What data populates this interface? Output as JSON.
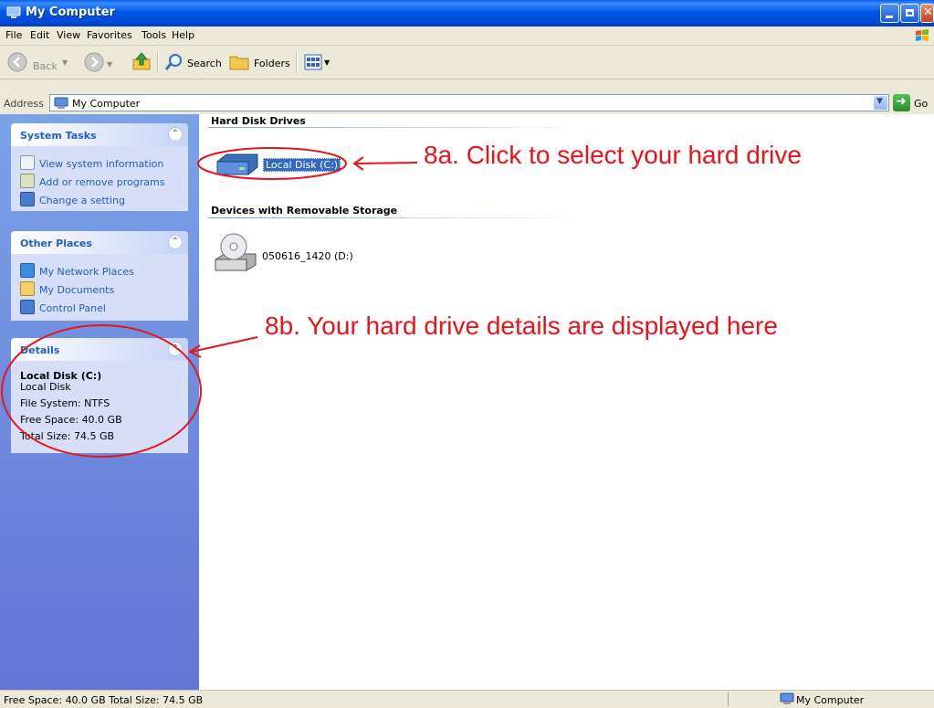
{
  "window": {
    "title": "My Computer"
  },
  "menu": [
    "File",
    "Edit",
    "View",
    "Favorites",
    "Tools",
    "Help"
  ],
  "toolbar": {
    "back_label": "Back",
    "search_label": "Search",
    "folders_label": "Folders"
  },
  "address": {
    "label": "Address",
    "value": "My Computer",
    "go_label": "Go"
  },
  "sidebar": {
    "system_tasks": {
      "title": "System Tasks",
      "items": [
        "View system information",
        "Add or remove programs",
        "Change a setting"
      ]
    },
    "other_places": {
      "title": "Other Places",
      "items": [
        "My Network Places",
        "My Documents",
        "Control Panel"
      ]
    },
    "details": {
      "title": "Details",
      "name": "Local Disk (C:)",
      "type": "Local Disk",
      "file_system": "File System: NTFS",
      "free_space": "Free Space: 40.0 GB",
      "total_size": "Total Size: 74.5 GB"
    }
  },
  "content": {
    "hard_disk_header": "Hard Disk Drives",
    "local_disk_label": "Local Disk (C:)",
    "removable_header": "Devices with Removable Storage",
    "cd_drive_label": "050616_1420 (D:)"
  },
  "annotations": {
    "a8a": "8a. Click to select your hard drive",
    "a8b": "8b. Your hard drive details are displayed here"
  },
  "statusbar": {
    "left": "Free Space: 40.0 GB Total Size: 74.5 GB",
    "right": "My Computer"
  },
  "colors": {
    "annotation": "#e8141a",
    "link": "#215dc6",
    "selection": "#316ac5"
  }
}
